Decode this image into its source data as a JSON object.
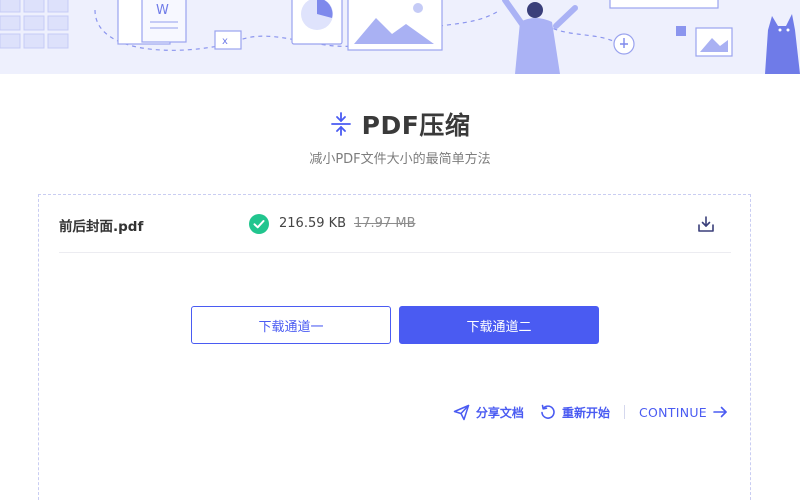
{
  "header": {
    "title": "PDF压缩",
    "subtitle": "减小PDF文件大小的最简单方法"
  },
  "file": {
    "name": "前后封面.pdf",
    "compressed_size": "216.59 KB",
    "original_size": "17.97 MB",
    "status": "success"
  },
  "buttons": {
    "channel_one": "下载通道一",
    "channel_two": "下载通道二"
  },
  "actions": {
    "share": "分享文档",
    "restart": "重新开始",
    "continue": "CONTINUE"
  },
  "icons": {
    "title": "compress-icon",
    "status": "check-circle-icon",
    "download": "download-icon",
    "share": "paper-plane-icon",
    "restart": "refresh-icon",
    "continue": "arrow-right-icon"
  },
  "colors": {
    "accent": "#4a5bf2",
    "success": "#21c58e",
    "banner": "#eef0fd"
  }
}
